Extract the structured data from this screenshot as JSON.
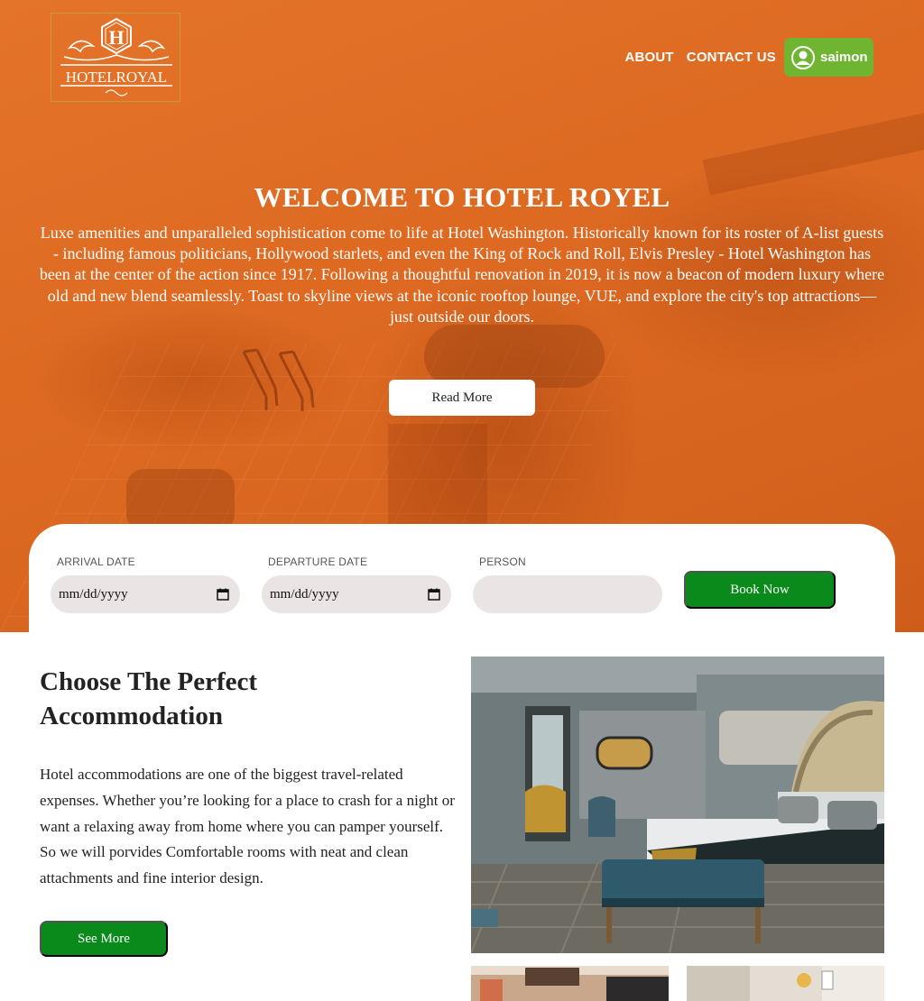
{
  "brand": {
    "logo_letter": "H",
    "logo_text": "HOTELROYAL"
  },
  "nav": {
    "links": [
      "ABOUT",
      "CONTACT US"
    ],
    "user_name": "saimon"
  },
  "hero": {
    "title": "WELCOME TO HOTEL ROYEL",
    "description": "Luxe amenities and unparalleled sophistication come to life at Hotel Washington. Historically known for its roster of A-list guests - including famous politicians, Hollywood starlets, and even the King of Rock and Roll, Elvis Presley - Hotel Washington has been at the center of the action since 1917. Following a thoughtful renovation in 2019, it is now a beacon of modern luxury where old and new blend seamlessly. Toast to skyline views at the iconic rooftop lounge, VUE, and explore the city's top attractions—just outside our doors.",
    "read_more_label": "Read More"
  },
  "booking": {
    "arrival_label": "ARRIVAL DATE",
    "arrival_value": "mm/dd/yyyy",
    "departure_label": "DEPARTURE DATE",
    "departure_value": "mm/dd/yyyy",
    "person_label": "PERSON",
    "person_value": "",
    "book_label": "Book Now"
  },
  "accommodation": {
    "title": "Choose The Perfect Accommodation",
    "description": "Hotel accommodations are one of the biggest travel-related expenses. Whether you’re looking for a place to crash for a night or want a relaxing away from home where you can pamper yourself. So we will porvides Comfortable rooms with neat and clean attachments and fine interior design.",
    "see_more_label": "See More"
  },
  "colors": {
    "hero_orange": "#de6a22",
    "user_green": "#6fb532",
    "button_green": "#0a8a1a",
    "field_bg": "#ebe4e4"
  },
  "icons": {
    "user": "user-circle-icon",
    "calendar": "calendar-icon",
    "logo_ornament": "ornament-icon"
  }
}
